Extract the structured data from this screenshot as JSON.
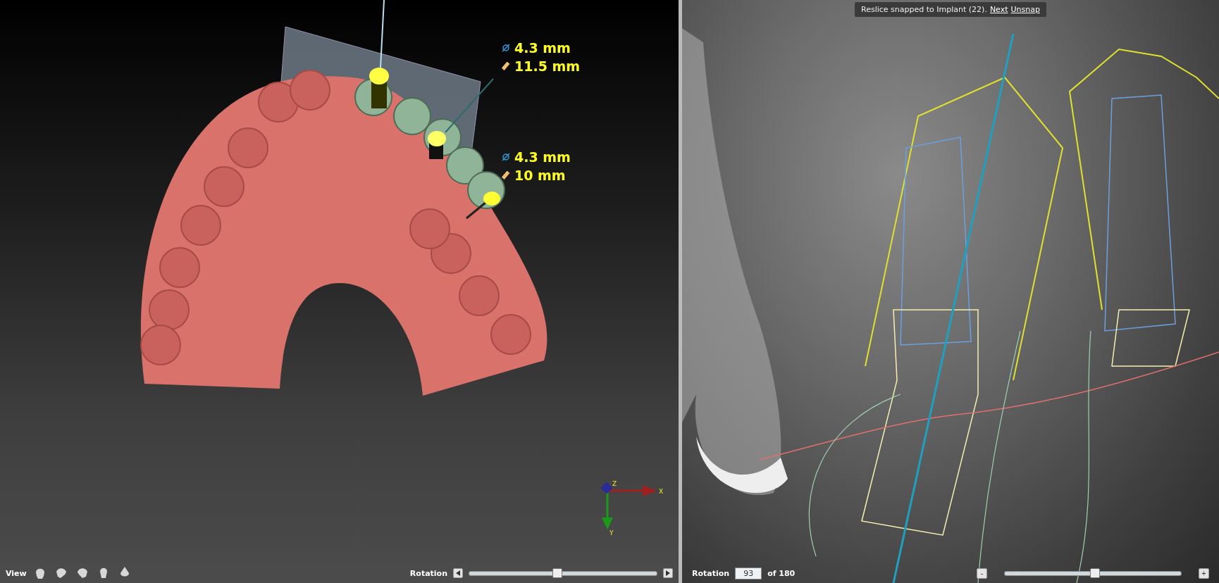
{
  "viewport_3d": {
    "measurements": [
      {
        "diameter": "4.3 mm",
        "length": "11.5 mm"
      },
      {
        "diameter": "4.3 mm",
        "length": "10 mm"
      }
    ],
    "axes": {
      "x": "X",
      "y": "Y",
      "z": "Z"
    }
  },
  "view_toolbar": {
    "label": "View",
    "rotation": {
      "label": "Rotation",
      "level": 0.47
    }
  },
  "reslice": {
    "banner": {
      "text": "Reslice snapped to Implant (22).",
      "links": [
        "Next",
        "Unsnap"
      ]
    },
    "rotation": {
      "label": "Rotation",
      "value": "93",
      "suffix": "of 180",
      "level": 0.51,
      "minus": "-",
      "plus": "+"
    }
  }
}
